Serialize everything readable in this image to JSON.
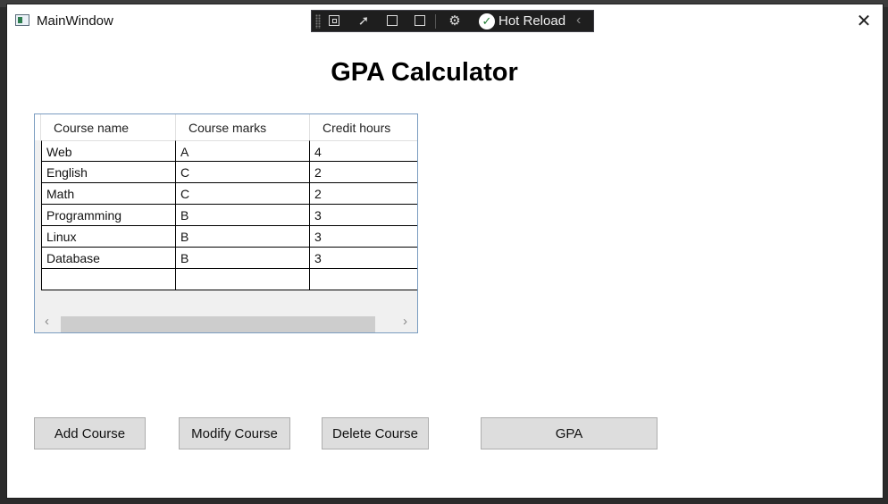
{
  "window": {
    "title": "MainWindow",
    "close_glyph": "✕"
  },
  "hot_reload": {
    "label": "Hot Reload",
    "check_glyph": "✓",
    "chevron_glyph": "‹"
  },
  "page": {
    "title": "GPA Calculator"
  },
  "table": {
    "headers": [
      "Course name",
      "Course marks",
      "Credit hours"
    ],
    "rows": [
      [
        "Web",
        "A",
        "4"
      ],
      [
        "English",
        "C",
        "2"
      ],
      [
        "Math",
        "C",
        "2"
      ],
      [
        "Programming",
        "B",
        "3"
      ],
      [
        "Linux",
        "B",
        "3"
      ],
      [
        "Database",
        "B",
        "3"
      ],
      [
        "",
        "",
        ""
      ]
    ],
    "scroll_left": "‹",
    "scroll_right": "›"
  },
  "buttons": {
    "add": "Add Course",
    "modify": "Modify Course",
    "delete": "Delete Course",
    "gpa": "GPA"
  },
  "colors": {
    "window_bg": "#ffffff",
    "button_bg": "#dddddd",
    "grid_border": "#7a9cc0",
    "toolbar_bg": "#1e1e1e"
  }
}
